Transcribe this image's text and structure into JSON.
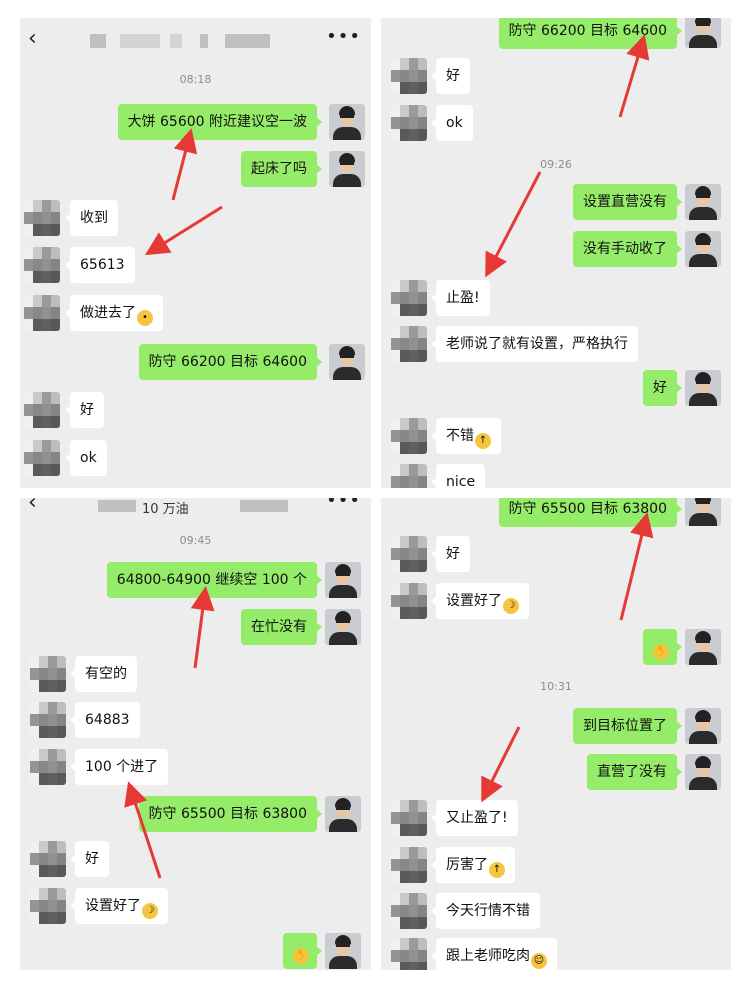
{
  "panel1": {
    "time": "08:18",
    "messages": [
      {
        "text": "大饼 65600 附近建议空一波"
      },
      {
        "text": "起床了吗"
      },
      {
        "text": "收到"
      },
      {
        "text": "65613"
      },
      {
        "text": "做进去了"
      },
      {
        "text": "防守 66200 目标 64600"
      },
      {
        "text": "好"
      },
      {
        "text": "ok"
      }
    ]
  },
  "panel2": {
    "time": "09:26",
    "messages": [
      {
        "text": "防守 66200 目标 64600"
      },
      {
        "text": "好"
      },
      {
        "text": "ok"
      },
      {
        "text": "设置直营没有"
      },
      {
        "text": "没有手动收了"
      },
      {
        "text": "止盈!"
      },
      {
        "text": "老师说了就有设置，严格执行"
      },
      {
        "text": "好"
      },
      {
        "text": "不错"
      },
      {
        "text": "nice"
      }
    ]
  },
  "panel3": {
    "title_fragment": "10 万油",
    "time": "09:45",
    "messages": [
      {
        "text": "64800-64900 继续空 100 个"
      },
      {
        "text": "在忙没有"
      },
      {
        "text": "有空的"
      },
      {
        "text": "64883"
      },
      {
        "text": "100 个进了"
      },
      {
        "text": "防守 65500 目标 63800"
      },
      {
        "text": "好"
      },
      {
        "text": "设置好了"
      }
    ]
  },
  "panel4": {
    "time": "10:31",
    "messages": [
      {
        "text": "防守 65500 目标 63800"
      },
      {
        "text": "好"
      },
      {
        "text": "设置好了"
      },
      {
        "text": "到目标位置了"
      },
      {
        "text": "直营了没有"
      },
      {
        "text": "又止盈了!"
      },
      {
        "text": "厉害了"
      },
      {
        "text": "今天行情不错"
      },
      {
        "text": "跟上老师吃肉"
      }
    ]
  },
  "icons": {
    "back": "chevron-left-icon",
    "more": "more-dots-icon",
    "thumbs_up": "thumbs-up-emoji-icon",
    "banana": "banana-emoji-icon",
    "wave": "wave-hand-emoji-icon",
    "grin": "grin-emoji-icon",
    "embarrassed": "embarrassed-emoji-icon"
  },
  "colors": {
    "outgoing_bubble": "#95ec69",
    "incoming_bubble": "#ffffff",
    "chat_background": "#ededed",
    "annotation_arrow": "#e53935"
  }
}
